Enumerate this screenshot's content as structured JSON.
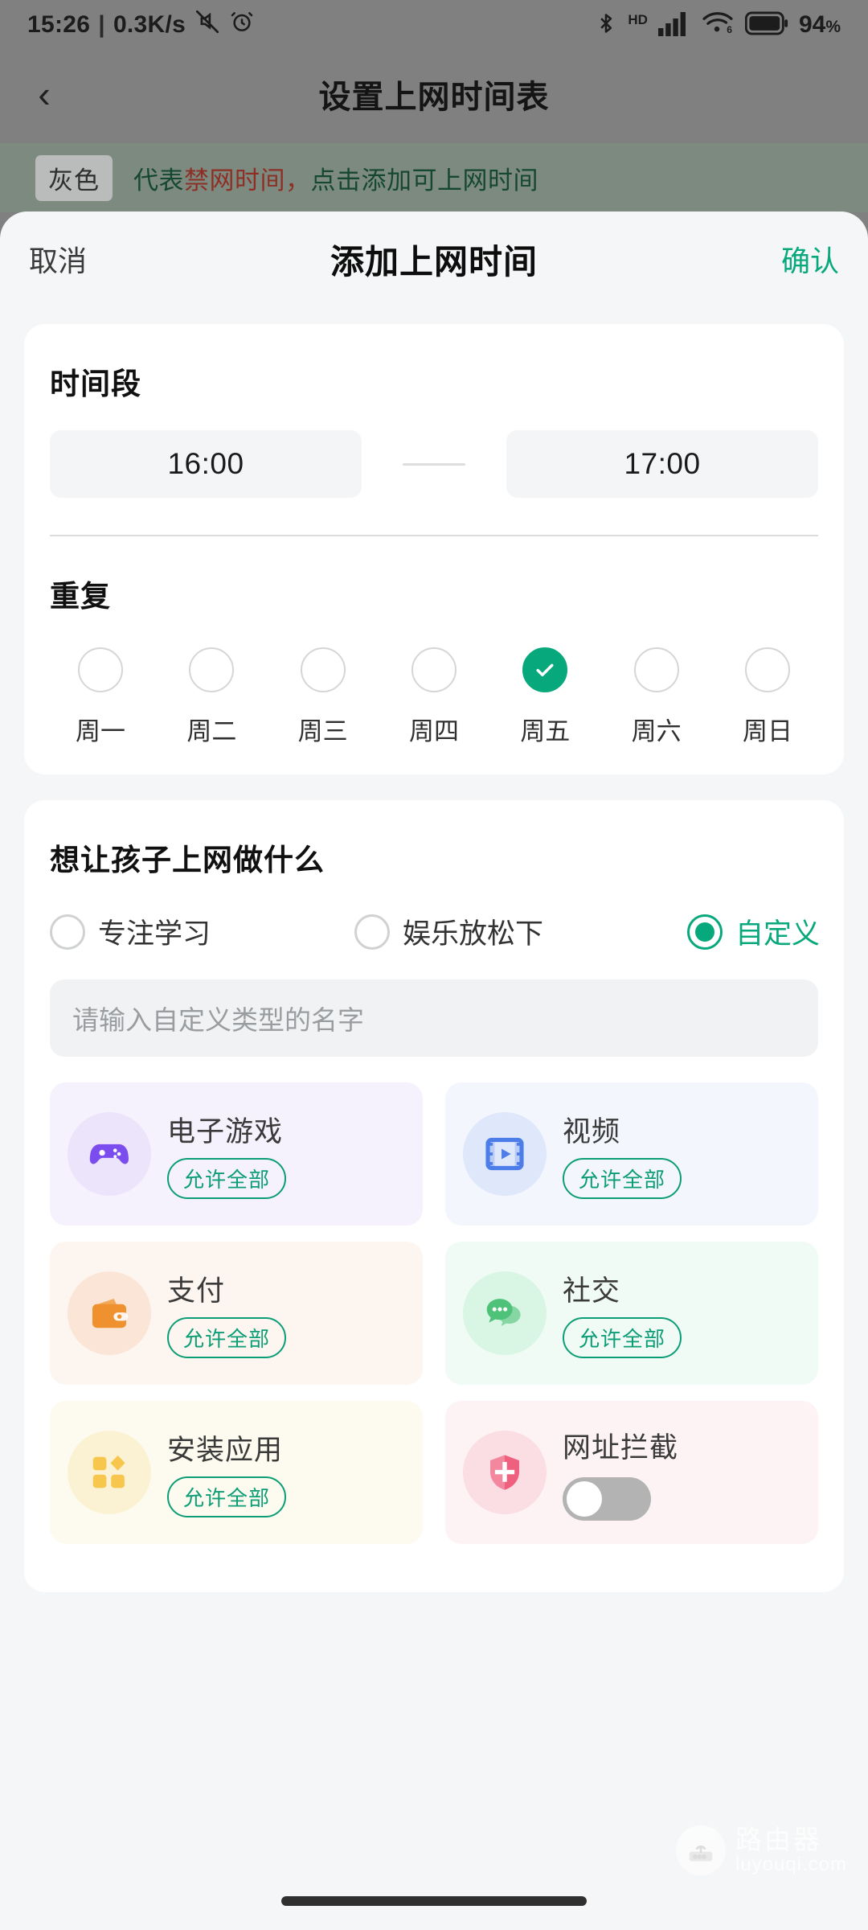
{
  "statusbar": {
    "time": "15:26",
    "separator": "|",
    "netspeed": "0.3K/s",
    "battery_percent": "94",
    "battery_unit": "%",
    "icons": [
      "mute-icon",
      "alarm-icon",
      "bluetooth-icon",
      "hd-icon",
      "signal-bars-icon",
      "wifi6-icon",
      "battery-icon"
    ]
  },
  "navbar": {
    "back": "‹",
    "title": "设置上网时间表"
  },
  "notice": {
    "badge": "灰色",
    "text_part1": "代表",
    "text_warn": "禁网时间，",
    "text_part2": "点击添加可上网时间"
  },
  "sheet": {
    "cancel": "取消",
    "title": "添加上网时间",
    "confirm": "确认"
  },
  "time_section": {
    "title": "时间段",
    "start": "16:00",
    "end": "17:00"
  },
  "repeat_section": {
    "title": "重复",
    "days": [
      {
        "label": "周一",
        "selected": false
      },
      {
        "label": "周二",
        "selected": false
      },
      {
        "label": "周三",
        "selected": false
      },
      {
        "label": "周四",
        "selected": false
      },
      {
        "label": "周五",
        "selected": true
      },
      {
        "label": "周六",
        "selected": false
      },
      {
        "label": "周日",
        "selected": false
      }
    ]
  },
  "purpose_section": {
    "title": "想让孩子上网做什么",
    "options": [
      {
        "label": "专注学习",
        "selected": false
      },
      {
        "label": "娱乐放松下",
        "selected": false
      },
      {
        "label": "自定义",
        "selected": true
      }
    ],
    "custom_input_placeholder": "请输入自定义类型的名字",
    "custom_input_value": ""
  },
  "categories": [
    {
      "name": "电子游戏",
      "icon": "gamepad-icon",
      "pill": "允许全部",
      "control": "pill",
      "bg": "#f6f2fd",
      "icon_bg": "#ece4fb",
      "icon_color": "#7c4dee"
    },
    {
      "name": "视频",
      "icon": "video-film-icon",
      "pill": "允许全部",
      "control": "pill",
      "bg": "#f4f6fe",
      "icon_bg": "#dfe7fb",
      "icon_color": "#4d7de8"
    },
    {
      "name": "支付",
      "icon": "wallet-icon",
      "pill": "允许全部",
      "control": "pill",
      "bg": "#fdf6f0",
      "icon_bg": "#fbe5d6",
      "icon_color": "#f0912f"
    },
    {
      "name": "社交",
      "icon": "chat-bubble-icon",
      "pill": "允许全部",
      "control": "pill",
      "bg": "#f1fbf5",
      "icon_bg": "#d9f5e4",
      "icon_color": "#4fc27a"
    },
    {
      "name": "安装应用",
      "icon": "apps-grid-icon",
      "pill": "允许全部",
      "control": "pill",
      "bg": "#fdfbef",
      "icon_bg": "#fbf2d4",
      "icon_color": "#f6c64d"
    },
    {
      "name": "网址拦截",
      "icon": "shield-icon",
      "pill": "",
      "control": "switch",
      "switch_on": false,
      "bg": "#fdf3f5",
      "icon_bg": "#fbdde4",
      "icon_color": "#ef5f7e"
    }
  ],
  "watermark": {
    "cn": "路由器",
    "en": "luyouqi.com",
    "icon": "router-icon"
  },
  "colors": {
    "accent": "#07a87c",
    "pill_border": "#0b9d76",
    "notice_bg": "#7c8a80",
    "notice_warn": "#8d2f25",
    "notice_green": "#16472f",
    "chrome_gray": "#808080"
  }
}
